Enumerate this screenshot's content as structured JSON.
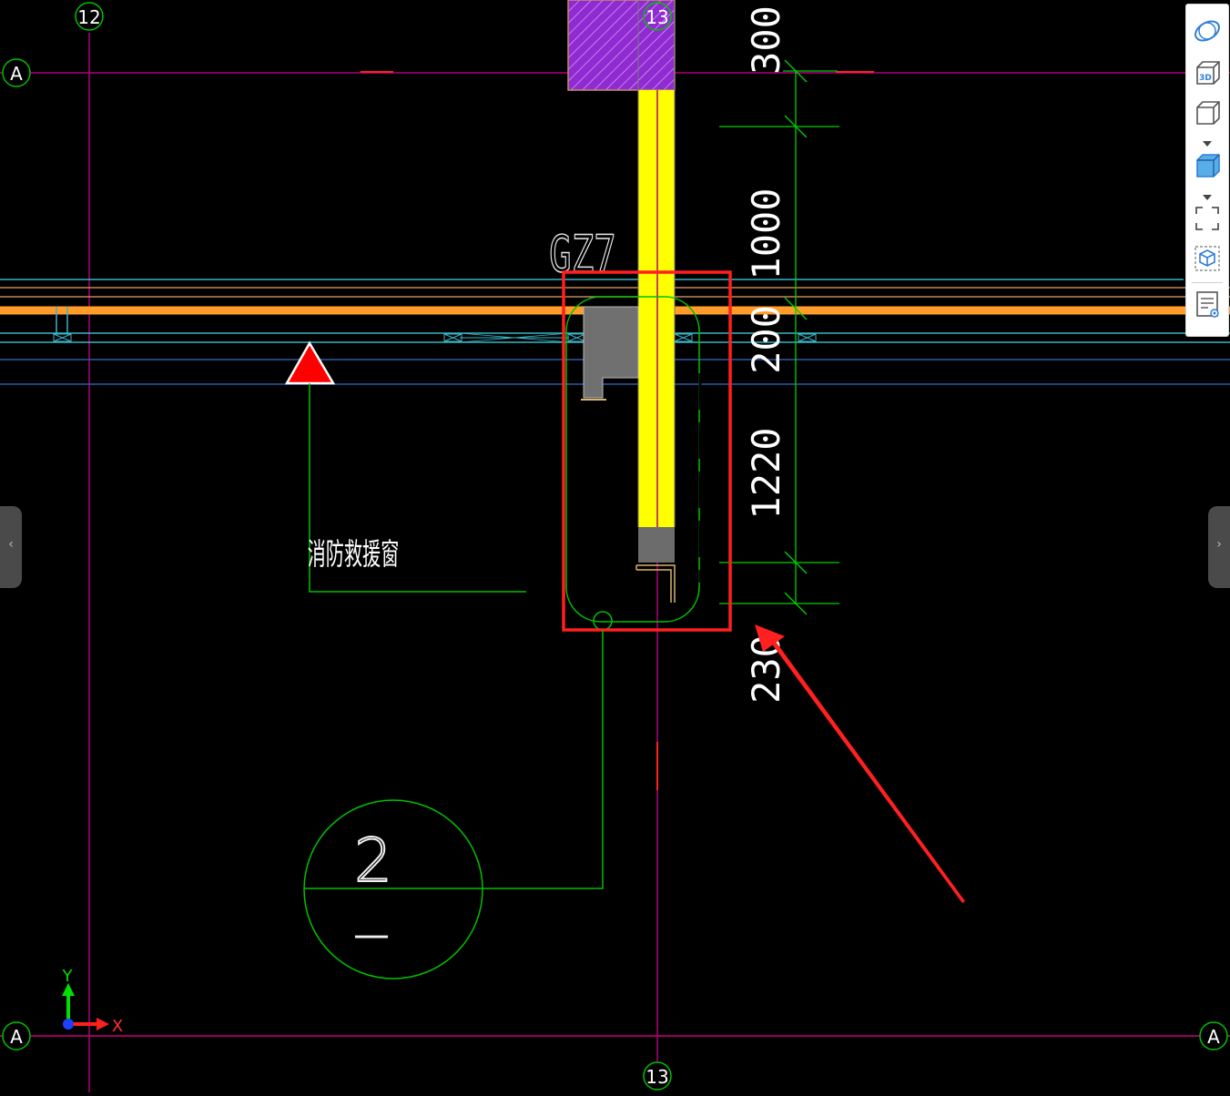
{
  "grid": {
    "axis_12": "12",
    "axis_13_top": "13",
    "axis_13_bottom": "13",
    "axis_a_top_left": "A",
    "axis_a_bottom_left": "A",
    "axis_a_bottom_right": "A"
  },
  "dimensions": {
    "d1": "300",
    "d2": "1000",
    "d3": "200",
    "d4": "1220",
    "d5": "230"
  },
  "labels": {
    "column_tag": "GZ7",
    "rescue_window": "消防救援窗",
    "detail_number": "2",
    "detail_sheet": "—"
  },
  "ucs": {
    "x_label": "X",
    "y_label": "Y"
  },
  "nav": {
    "left_arrow": "‹",
    "right_arrow": "›"
  },
  "colors": {
    "background": "#000000",
    "axis_line": "#b0007a",
    "grid_bubble": "#00c000",
    "column_fill": "#ffff00",
    "hatch_fill": "#9a30d8",
    "dimension": "#00d000",
    "wall_orange": "#ff9c2a",
    "wall_cyan": "#37b6c8",
    "highlight_red": "#ff1f1f"
  }
}
